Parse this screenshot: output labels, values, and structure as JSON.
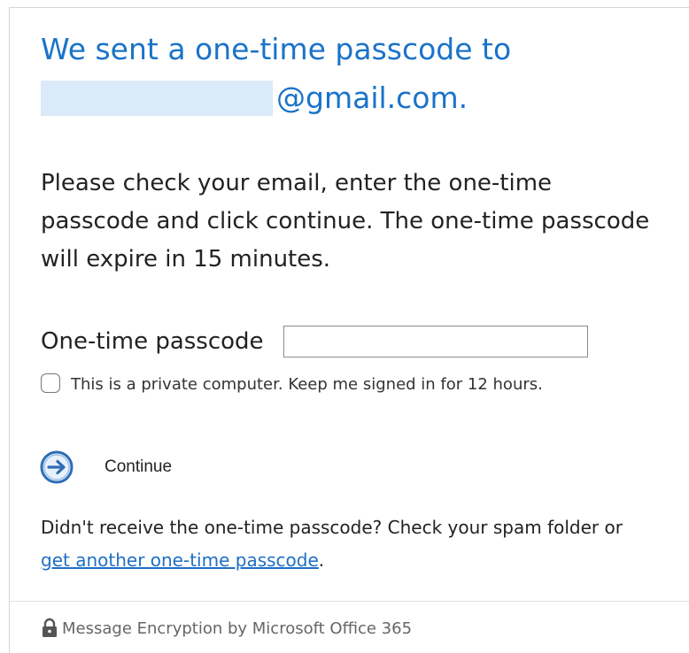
{
  "heading": {
    "line1": "We sent a one-time passcode to",
    "email_suffix": "@gmail.com."
  },
  "instructions": "Please check your email, enter the one-time passcode and click continue. The one-time passcode will expire in 15 minutes.",
  "passcode": {
    "label": "One-time passcode",
    "value": "",
    "placeholder": ""
  },
  "keep_signed_in": {
    "label": "This is a private computer. Keep me signed in for 12 hours.",
    "checked": false
  },
  "continue": {
    "label": "Continue",
    "icon": "arrow-right-circle-icon"
  },
  "help": {
    "text": "Didn't receive the one-time passcode? Check your spam folder or ",
    "link_label": "get another one-time passcode",
    "suffix": "."
  },
  "footer": {
    "icon": "lock-icon",
    "text": "Message Encryption by Microsoft Office 365"
  },
  "colors": {
    "heading": "#1a73c9",
    "link": "#1f6fc5",
    "redaction": "#dbeaf8",
    "continue_icon": "#2f6db5"
  }
}
